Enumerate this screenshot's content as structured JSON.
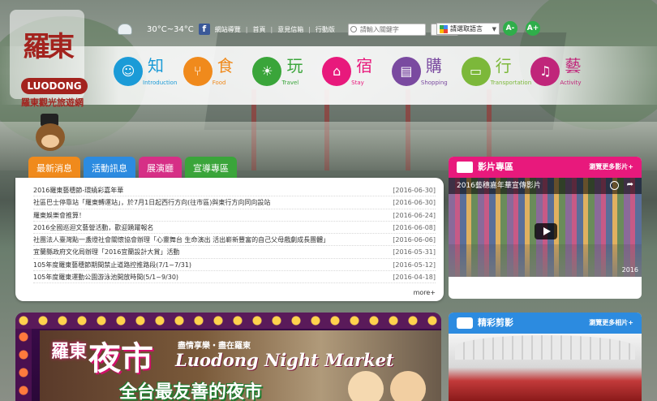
{
  "logo": {
    "chinese": "羅東",
    "english": "LUODONG",
    "subtitle": "羅東觀光旅遊網"
  },
  "topbar": {
    "temperature": "30°C~34°C",
    "links": [
      "網站導覽",
      "首頁",
      "意見信箱",
      "行動版"
    ],
    "search": {
      "placeholder": "請輸入關鍵字",
      "button": "查詢"
    },
    "language": "請選取語言",
    "font_smaller": "A-",
    "font_larger": "A+"
  },
  "nav": [
    {
      "zh": "知",
      "en": "Introduction",
      "color": "#1b9bd7",
      "icon": "info-person-icon"
    },
    {
      "zh": "食",
      "en": "Food",
      "color": "#f08a1c",
      "icon": "utensils-icon"
    },
    {
      "zh": "玩",
      "en": "Travel",
      "color": "#3aa53a",
      "icon": "sun-landscape-icon"
    },
    {
      "zh": "宿",
      "en": "Stay",
      "color": "#e8197c",
      "icon": "house-icon"
    },
    {
      "zh": "購",
      "en": "Shopping",
      "color": "#7a4aa0",
      "icon": "shop-icon"
    },
    {
      "zh": "行",
      "en": "Transportation",
      "color": "#7cb83a",
      "icon": "bus-icon"
    },
    {
      "zh": "藝",
      "en": "Activity",
      "color": "#c0267a",
      "icon": "dancer-icon"
    }
  ],
  "tabs": [
    {
      "label": "最新消息",
      "color": "#f08a1c"
    },
    {
      "label": "活動訊息",
      "color": "#2c8be0"
    },
    {
      "label": "展演廳",
      "color": "#d62f86"
    },
    {
      "label": "宣導專區",
      "color": "#3aa53a"
    }
  ],
  "news": [
    {
      "title": "2016羅東藝穗節-環繞彩嘉年華",
      "date": "[2016-06-30]"
    },
    {
      "title": "社區巴士停靠站「羅東轉運站」，於7月1日起西行方向(往市區)與東行方向同向設站",
      "date": "[2016-06-30]"
    },
    {
      "title": "羅東娛樂會推算！",
      "date": "[2016-06-24]"
    },
    {
      "title": "2016全國巡迴文藝營活動，歡迎踴躍報名",
      "date": "[2016-06-08]"
    },
    {
      "title": "社團法人臺灣點一盞燈社會關懷協會辦理「心靈舞台 生命演出 活出嶄新豐富的自己父母戲劇成長團體」",
      "date": "[2016-06-06]"
    },
    {
      "title": "宜蘭縣政府文化局辦理「2016宜蘭設計大賞」活動",
      "date": "[2016-05-31]"
    },
    {
      "title": "105年度羅東藝穗節期間禁止道路控推路段(7/1~7/31)",
      "date": "[2016-05-12]"
    },
    {
      "title": "105年度羅東運動公園游泳池開放時間(5/1~9/30)",
      "date": "[2016-04-18]"
    }
  ],
  "news_more": "more+",
  "video_panel": {
    "title": "影片專區",
    "more": "瀏覽更多影片+",
    "video_title": "2016藝穗嘉年華宣傳影片",
    "video_year": "2016"
  },
  "photo_panel": {
    "title": "精彩剪影",
    "more": "瀏覽更多相片+"
  },
  "banner": {
    "zh_small": "羅東",
    "zh_large": "夜市",
    "tagline": "盡情享樂・盡在羅東",
    "english": "Luodong Night Market",
    "slogan": "全台最友善的夜市"
  }
}
